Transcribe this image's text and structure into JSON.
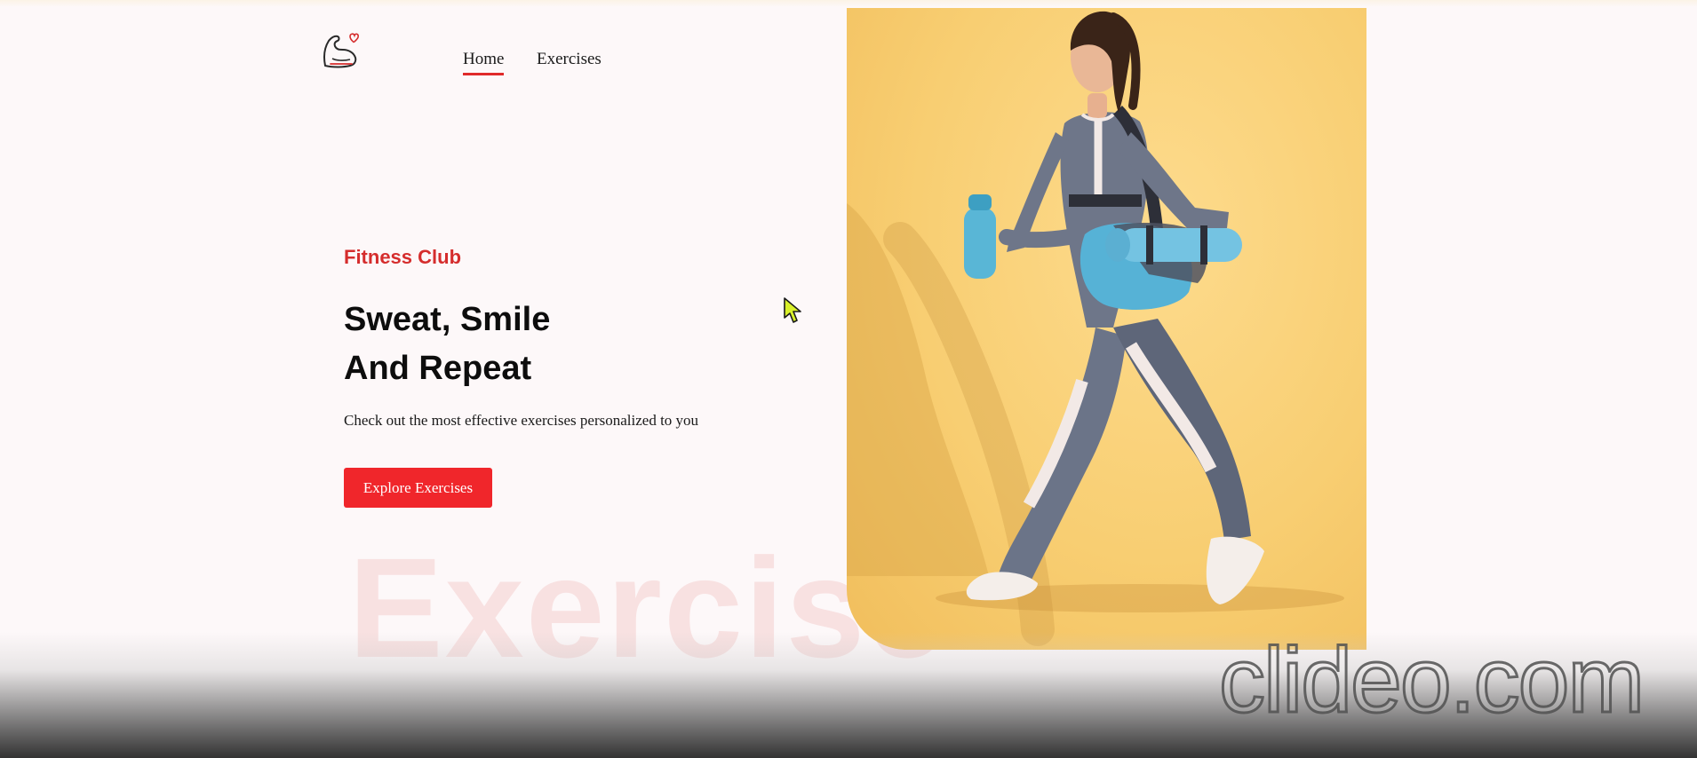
{
  "nav": {
    "logo_icon": "flexed-arm-heart-icon",
    "links": [
      {
        "label": "Home",
        "active": true
      },
      {
        "label": "Exercises",
        "active": false
      }
    ]
  },
  "hero": {
    "eyebrow": "Fitness Club",
    "headline_line1": "Sweat, Smile",
    "headline_line2": "And Repeat",
    "subtitle": "Check out the most effective exercises personalized to you",
    "cta_label": "Explore Exercises",
    "background_word": "Exercise",
    "image_icon": "woman-walking-with-gym-bag-image"
  },
  "watermark": "clideo.com",
  "colors": {
    "accent": "#e02a2a",
    "button": "#f0262b",
    "eyebrow": "#d52d2d",
    "background": "#fdf8f9",
    "image_background": "#f8ce72"
  }
}
